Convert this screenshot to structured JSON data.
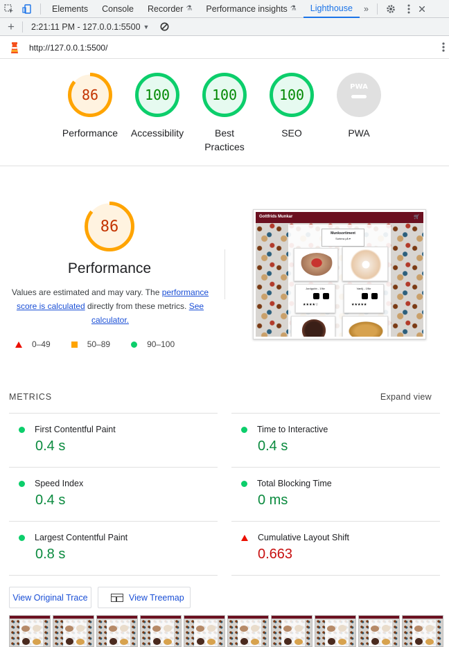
{
  "devtools": {
    "tabs": [
      "Elements",
      "Console",
      "Recorder",
      "Performance insights",
      "Lighthouse"
    ],
    "active_tab": "Lighthouse",
    "more": "»"
  },
  "report_toolbar": {
    "add": "+",
    "report_selector": "2:21:11 PM - 127.0.0.1:5500",
    "caret": "▼"
  },
  "url_bar": {
    "url": "http://127.0.0.1:5500/"
  },
  "gauges": [
    {
      "label": "Performance",
      "score": "86",
      "value": 86,
      "color": "#ffa400",
      "text_color": "#c33300",
      "fill": "#fff3e0"
    },
    {
      "label": "Accessibility",
      "score": "100",
      "value": 100,
      "color": "#0cce6b",
      "text_color": "#008800",
      "fill": "#e6faf0"
    },
    {
      "label": "Best Practices",
      "score": "100",
      "value": 100,
      "color": "#0cce6b",
      "text_color": "#008800",
      "fill": "#e6faf0"
    },
    {
      "label": "SEO",
      "score": "100",
      "value": 100,
      "color": "#0cce6b",
      "text_color": "#008800",
      "fill": "#e6faf0"
    },
    {
      "label": "PWA",
      "score": "PWA",
      "value": 0,
      "color": "#e0e0e0",
      "text_color": "#9e9e9e",
      "fill": "#e0e0e0"
    }
  ],
  "performance": {
    "score": "86",
    "value": 86,
    "title": "Performance",
    "desc_pre": "Values are estimated and may vary. The ",
    "desc_link1": "performance score is calculated",
    "desc_mid": " directly from these metrics. ",
    "desc_link2": "See calculator.",
    "legend": [
      "0–49",
      "50–89",
      "90–100"
    ]
  },
  "screenshot": {
    "site_title": "Gottfrids Munkar",
    "cart_icon": "shopping-cart-icon",
    "panel_title": "Munksortiment",
    "panel_sub": "Sortera på ▾",
    "item1": "Jordgubb - 19kr",
    "item2": "Vanilj - 19kr",
    "stars1": "★★★★☆",
    "stars2": "★★★★★"
  },
  "metrics": {
    "heading": "METRICS",
    "expand": "Expand view",
    "items": [
      {
        "name": "First Contentful Paint",
        "value": "0.4 s",
        "status": "pass"
      },
      {
        "name": "Time to Interactive",
        "value": "0.4 s",
        "status": "pass"
      },
      {
        "name": "Speed Index",
        "value": "0.4 s",
        "status": "pass"
      },
      {
        "name": "Total Blocking Time",
        "value": "0 ms",
        "status": "pass"
      },
      {
        "name": "Largest Contentful Paint",
        "value": "0.8 s",
        "status": "pass"
      },
      {
        "name": "Cumulative Layout Shift",
        "value": "0.663",
        "status": "fail"
      }
    ]
  },
  "buttons": {
    "trace": "View Original Trace",
    "treemap": "View Treemap"
  },
  "colors": {
    "pass": "#0cce6b",
    "average": "#ffa400",
    "fail": "#eb0f00",
    "link": "#1a4fd6"
  }
}
